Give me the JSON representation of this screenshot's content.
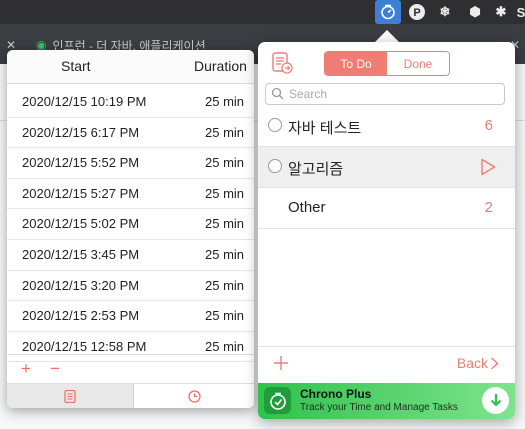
{
  "background": {
    "tab_label": "인프런 - 더 자바, 애플리케이션"
  },
  "history": {
    "col_start": "Start",
    "col_duration": "Duration",
    "rows": [
      {
        "start": "2020/12/15 10:19 PM",
        "duration": "25 min"
      },
      {
        "start": "2020/12/15 6:17 PM",
        "duration": "25 min"
      },
      {
        "start": "2020/12/15 5:52 PM",
        "duration": "25 min"
      },
      {
        "start": "2020/12/15 5:27 PM",
        "duration": "25 min"
      },
      {
        "start": "2020/12/15 5:02 PM",
        "duration": "25 min"
      },
      {
        "start": "2020/12/15 3:45 PM",
        "duration": "25 min"
      },
      {
        "start": "2020/12/15 3:20 PM",
        "duration": "25 min"
      },
      {
        "start": "2020/12/15 2:53 PM",
        "duration": "25 min"
      },
      {
        "start": "2020/12/15 12:58 PM",
        "duration": "25 min"
      }
    ],
    "add_label": "+",
    "remove_label": "−"
  },
  "main": {
    "segment": {
      "todo": "To Do",
      "done": "Done",
      "active": "todo"
    },
    "search_placeholder": "Search",
    "tasks": [
      {
        "name": "자바 테스트",
        "count": "6",
        "status": "normal"
      },
      {
        "name": "알고리즘",
        "count": "",
        "status": "running"
      },
      {
        "name": "Other",
        "count": "2",
        "status": "normal"
      }
    ],
    "back_label": "Back"
  },
  "promo": {
    "title": "Chrono Plus",
    "subtitle": "Track your Time and Manage Tasks"
  },
  "colors": {
    "accent": "#f07d74",
    "promo_green": "#2fc24c",
    "menubar": "#2f2f31"
  }
}
